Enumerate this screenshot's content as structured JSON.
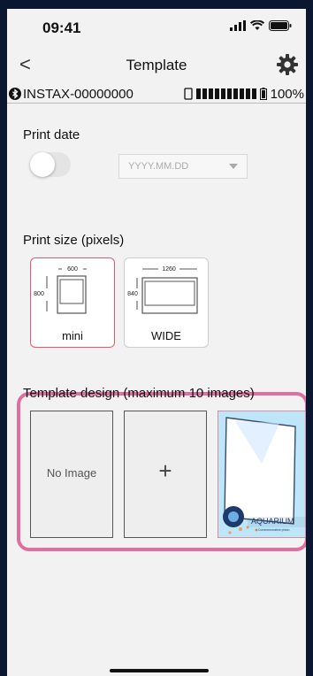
{
  "status": {
    "time": "09:41",
    "icons": [
      "signal-icon",
      "wifi-icon",
      "battery-icon"
    ]
  },
  "nav": {
    "back_glyph": "<",
    "title": "Template",
    "settings_icon": "gear-icon"
  },
  "device": {
    "name": "INSTAX-00000000",
    "battery": "100%",
    "icons": [
      "bluetooth-icon",
      "phone-icon",
      "charge-level-bars",
      "printer-battery-icon"
    ]
  },
  "print_date": {
    "label": "Print date",
    "toggle_on": false,
    "date_placeholder": "YYYY.MM.DD"
  },
  "print_size": {
    "label": "Print size (pixels)",
    "options": [
      {
        "name": "mini",
        "width_px": "600",
        "height_px": "800",
        "selected": true
      },
      {
        "name": "WIDE",
        "width_px": "1260",
        "height_px": "840",
        "selected": false
      }
    ]
  },
  "template_design": {
    "label": "Template design (maximum 10 images)",
    "tiles": [
      {
        "type": "empty",
        "text": "No Image"
      },
      {
        "type": "add",
        "text": "+"
      },
      {
        "type": "image",
        "text": "AQUARIUM",
        "subtext": "Commemorative photo"
      }
    ]
  },
  "colors": {
    "accent_pink": "#e06ea0",
    "selected_red": "#e25a6a",
    "background": "#f2f2f2"
  }
}
